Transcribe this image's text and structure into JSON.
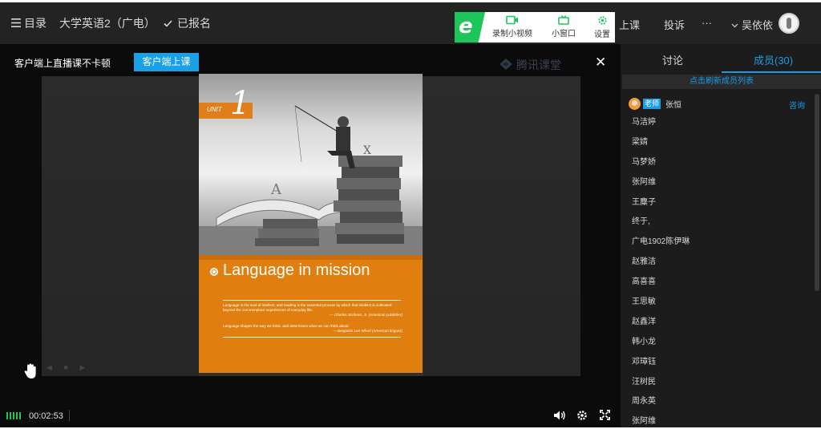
{
  "header": {
    "menu_label": "目录",
    "course_title": "大学英语2（广电）",
    "enrolled_label": "已报名",
    "toolbox": {
      "logo_letter": "e",
      "record_label": "录制小视频",
      "mini_window_label": "小窗口",
      "settings_label": "设置"
    },
    "go_class_label": "上课",
    "complain_label": "投诉",
    "more_label": "···",
    "username": "吴依依"
  },
  "video": {
    "notice": "客户端上直播课不卡顿",
    "client_button": "客户端上课",
    "watermark": "腾讯课堂",
    "close_glyph": "✕",
    "slide": {
      "unit_label": "UNIT",
      "unit_number": "1",
      "title": "Language in mission",
      "quote1": "Language is the soul of intellect, and reading is the essential process by which that intellect is cultivated beyond the commonplace experiences of everyday life.",
      "quote1_source": "— Charles Scribner, Jr. (American publisher)",
      "quote2": "Language shapes the way we think, and determines what we can think about.",
      "quote2_source": "— Benjamin Lee Whorf (American linguist)"
    },
    "elapsed_time": "00:02:53"
  },
  "sidebar": {
    "tab_discuss": "讨论",
    "tab_members": "成员(30)",
    "refresh_label": "点击刷新成员列表",
    "teacher": {
      "badge": "老师",
      "name": "张恒",
      "action": "咨询"
    },
    "members": [
      "马洁婷",
      "梁婧",
      "马梦娇",
      "张阿维",
      "王麋子",
      "终于,",
      "广电1902陈伊琳",
      "赵雅洁",
      "高喜喜",
      "王思敏",
      "赵鑫洋",
      "韩小龙",
      "邓璋钰",
      "汪树民",
      "周永英",
      "张阿维"
    ]
  },
  "icons": {
    "menu": "menu-icon",
    "check": "check-icon",
    "record": "video-record-icon",
    "mini_window": "tv-icon",
    "settings": "gear-icon",
    "user_dropdown": "chevron-down-icon",
    "hand": "raise-hand-icon",
    "volume": "volume-icon",
    "video_settings": "gear-icon",
    "fullscreen": "fullscreen-icon"
  },
  "colors": {
    "accent": "#1a9be8",
    "live_green": "#1ec55a",
    "slide_orange": "#e07f10"
  }
}
